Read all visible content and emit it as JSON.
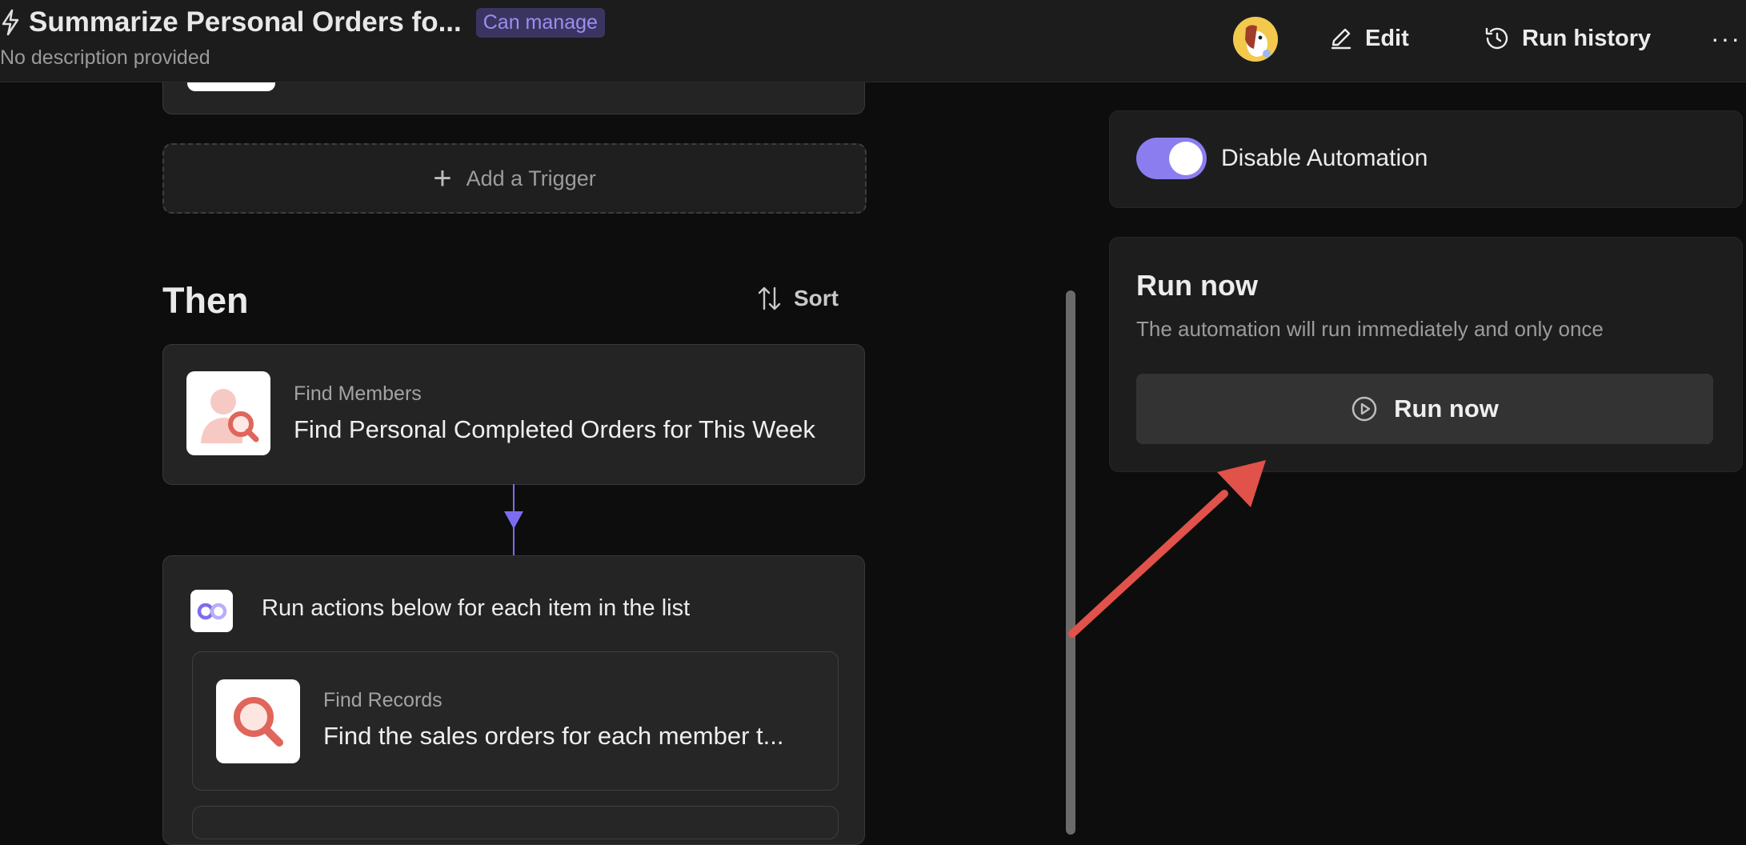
{
  "header": {
    "title": "Summarize Personal Orders fo...",
    "role_badge": "Can manage",
    "subtitle": "No description provided",
    "edit_label": "Edit",
    "history_label": "Run history",
    "more_label": "···"
  },
  "trigger": {
    "add_label": "Add a Trigger"
  },
  "then": {
    "title": "Then",
    "sort_label": "Sort",
    "step1": {
      "kind": "Find Members",
      "name": "Find Personal Completed Orders for This Week"
    },
    "loop": {
      "label": "Run actions below for each item in the list",
      "step": {
        "kind": "Find Records",
        "name": "Find the sales orders for each member t..."
      }
    }
  },
  "side": {
    "toggle_label": "Disable Automation",
    "toggle_on": true,
    "run_title": "Run now",
    "run_desc": "The automation will run immediately and only once",
    "run_button": "Run now"
  },
  "colors": {
    "accent": "#8b7df0",
    "badge_bg": "#3a3560",
    "annotation": "#e0524a",
    "search_red": "#e0655a"
  }
}
